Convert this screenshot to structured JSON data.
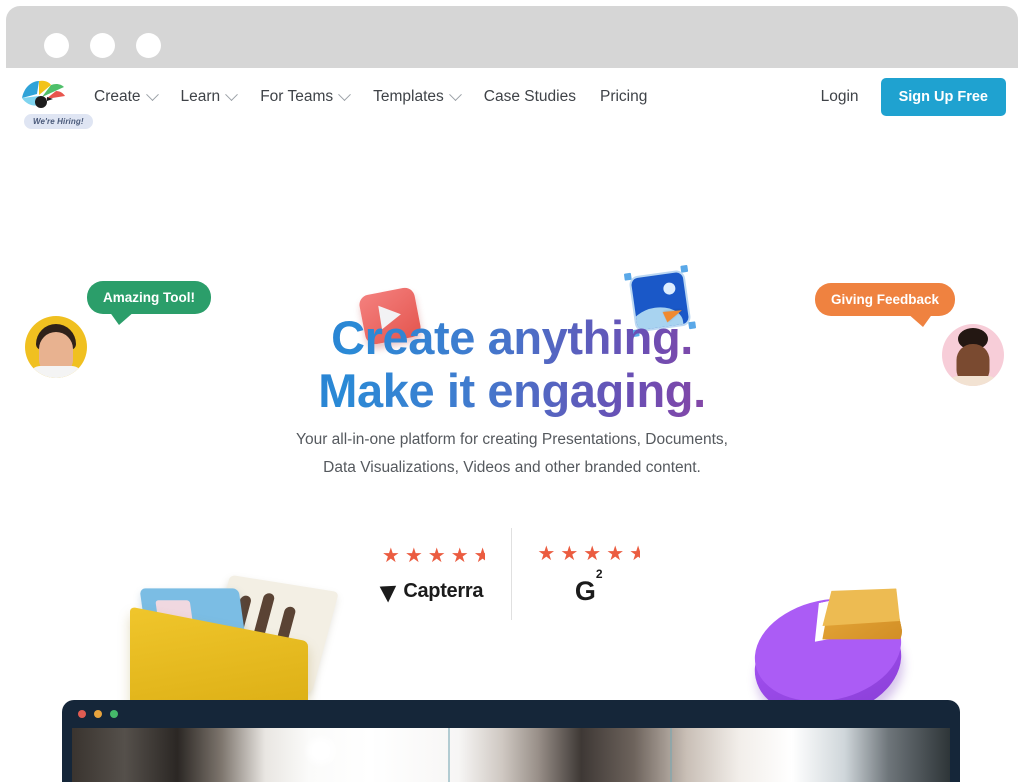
{
  "browser": {
    "dots": [
      "window-dot-1",
      "window-dot-2",
      "window-dot-3"
    ]
  },
  "nav": {
    "logo_name": "visme-logo",
    "hiring_badge": "We're Hiring!",
    "items": [
      {
        "label": "Create",
        "has_dropdown": true
      },
      {
        "label": "Learn",
        "has_dropdown": true
      },
      {
        "label": "For Teams",
        "has_dropdown": true
      },
      {
        "label": "Templates",
        "has_dropdown": true
      },
      {
        "label": "Case Studies",
        "has_dropdown": false
      },
      {
        "label": "Pricing",
        "has_dropdown": false
      }
    ],
    "login_label": "Login",
    "signup_label": "Sign Up Free",
    "signup_color": "#1fa2d0"
  },
  "hero": {
    "headline_line1": "Create anything.",
    "headline_line2": "Make it engaging.",
    "headline_gradient_start": "#2447b0",
    "headline_gradient_end": "#d02a68",
    "subhead_line1": "Your all-in-one platform for creating Presentations, Documents,",
    "subhead_line2": "Data Visualizations, Videos and other branded content."
  },
  "testimonials": [
    {
      "text": "Amazing Tool!",
      "color": "#2b9e6a",
      "avatar": "avatar-male",
      "avatar_bg": "#f0c020"
    },
    {
      "text": "Giving Feedback",
      "color": "#ef8240",
      "avatar": "avatar-female",
      "avatar_bg": "#f7cdd8"
    }
  ],
  "floating_icons": [
    {
      "name": "video-play-icon",
      "color": "#e4564f"
    },
    {
      "name": "image-select-icon",
      "color": "#1a58c8"
    }
  ],
  "ratings": {
    "star_color": "#eb5c40",
    "items": [
      {
        "brand": "Capterra",
        "stars_full": 4,
        "stars_half": 1,
        "rating": "4.5"
      },
      {
        "brand": "G2",
        "brand_sup": "2",
        "stars_full": 4,
        "stars_half": 1,
        "rating": "4.5"
      }
    ],
    "star_glyph": "★"
  },
  "illustrations": [
    {
      "name": "folder-documents-3d",
      "colors": [
        "#f0c62c",
        "#7bbde4",
        "#f3efe4"
      ]
    },
    {
      "name": "pie-chart-3d",
      "colors": [
        "#ab5cf5",
        "#edbb52"
      ]
    }
  ],
  "video_window": {
    "name": "video-preview-window",
    "frame_color": "#152639",
    "dots": [
      "#e05c52",
      "#e8a33d",
      "#45b96a"
    ]
  }
}
